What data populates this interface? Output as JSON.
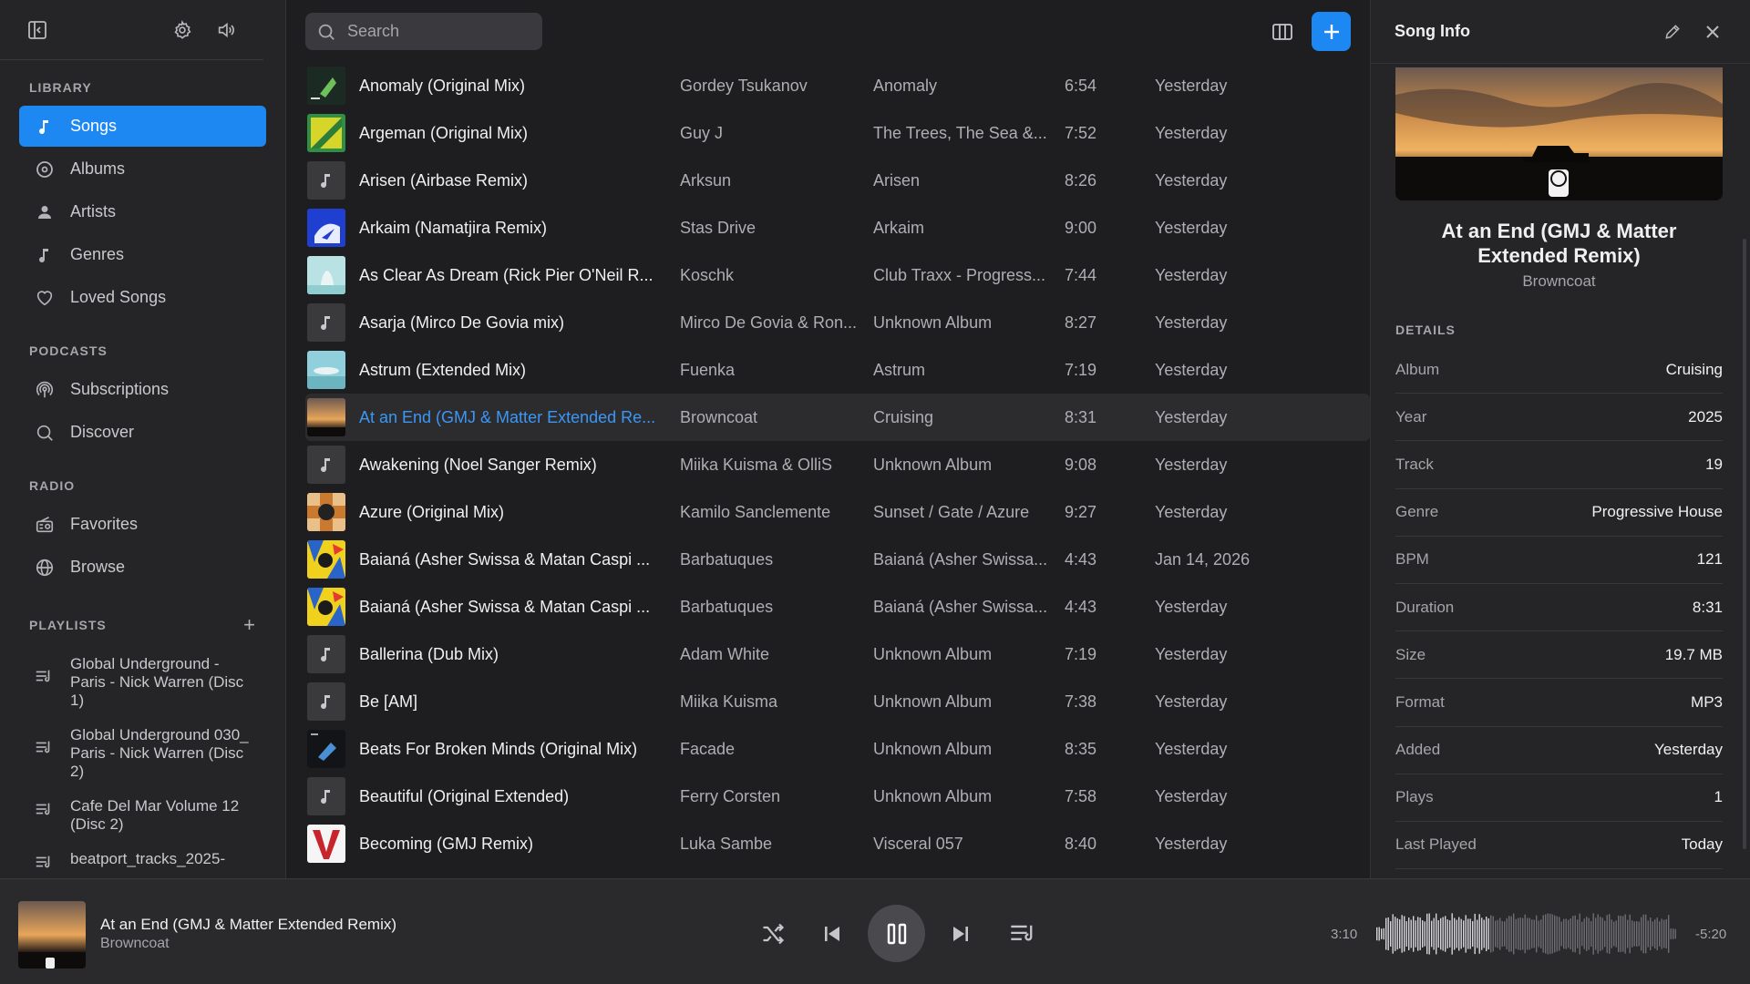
{
  "sidebar": {
    "sections": {
      "library": "LIBRARY",
      "podcasts": "PODCASTS",
      "radio": "RADIO",
      "playlists": "PLAYLISTS"
    },
    "library_items": [
      {
        "label": "Songs",
        "icon": "music-note-icon"
      },
      {
        "label": "Albums",
        "icon": "disc-icon"
      },
      {
        "label": "Artists",
        "icon": "person-icon"
      },
      {
        "label": "Genres",
        "icon": "music-note-icon"
      },
      {
        "label": "Loved Songs",
        "icon": "heart-icon"
      }
    ],
    "podcast_items": [
      {
        "label": "Subscriptions",
        "icon": "podcast-icon"
      },
      {
        "label": "Discover",
        "icon": "search-icon"
      }
    ],
    "radio_items": [
      {
        "label": "Favorites",
        "icon": "radio-icon"
      },
      {
        "label": "Browse",
        "icon": "globe-icon"
      }
    ],
    "playlists": [
      {
        "label": "Global Underground - Paris - Nick Warren (Disc 1)"
      },
      {
        "label": "Global Underground 030_ Paris - Nick Warren (Disc 2)"
      },
      {
        "label": "Cafe Del Mar Volume 12 (Disc 2)"
      },
      {
        "label": "beatport_tracks_2025-"
      }
    ]
  },
  "search": {
    "placeholder": "Search"
  },
  "songs": [
    {
      "title": "Anomaly (Original Mix)",
      "artist": "Gordey Tsukanov",
      "album": "Anomaly",
      "duration": "6:54",
      "added": "Yesterday",
      "art": "dark-green"
    },
    {
      "title": "Argeman (Original Mix)",
      "artist": "Guy J",
      "album": "The Trees, The Sea &...",
      "duration": "7:52",
      "added": "Yesterday",
      "art": "yellow-green"
    },
    {
      "title": "Arisen (Airbase Remix)",
      "artist": "Arksun",
      "album": "Arisen",
      "duration": "8:26",
      "added": "Yesterday",
      "art": "placeholder"
    },
    {
      "title": "Arkaim (Namatjira Remix)",
      "artist": "Stas Drive",
      "album": "Arkaim",
      "duration": "9:00",
      "added": "Yesterday",
      "art": "blue"
    },
    {
      "title": "As Clear As Dream (Rick Pier O'Neil R...",
      "artist": "Koschk",
      "album": "Club Traxx - Progress...",
      "duration": "7:44",
      "added": "Yesterday",
      "art": "teal"
    },
    {
      "title": "Asarja (Mirco De Govia mix)",
      "artist": "Mirco De Govia & Ron...",
      "album": "Unknown Album",
      "duration": "8:27",
      "added": "Yesterday",
      "art": "placeholder"
    },
    {
      "title": "Astrum (Extended Mix)",
      "artist": "Fuenka",
      "album": "Astrum",
      "duration": "7:19",
      "added": "Yesterday",
      "art": "sky"
    },
    {
      "title": "At an End (GMJ & Matter Extended Re...",
      "artist": "Browncoat",
      "album": "Cruising",
      "duration": "8:31",
      "added": "Yesterday",
      "art": "sunset",
      "current": true
    },
    {
      "title": "Awakening (Noel Sanger Remix)",
      "artist": "Miika Kuisma & OlliS",
      "album": "Unknown Album",
      "duration": "9:08",
      "added": "Yesterday",
      "art": "placeholder"
    },
    {
      "title": "Azure (Original Mix)",
      "artist": "Kamilo Sanclemente",
      "album": "Sunset / Gate / Azure",
      "duration": "9:27",
      "added": "Yesterday",
      "art": "checker"
    },
    {
      "title": "Baianá (Asher Swissa & Matan Caspi ...",
      "artist": "Barbatuques",
      "album": "Baianá (Asher Swissa...",
      "duration": "4:43",
      "added": "Jan 14, 2026",
      "art": "colorful"
    },
    {
      "title": "Baianá (Asher Swissa & Matan Caspi ...",
      "artist": "Barbatuques",
      "album": "Baianá (Asher Swissa...",
      "duration": "4:43",
      "added": "Yesterday",
      "art": "colorful"
    },
    {
      "title": "Ballerina (Dub Mix)",
      "artist": "Adam White",
      "album": "Unknown Album",
      "duration": "7:19",
      "added": "Yesterday",
      "art": "placeholder"
    },
    {
      "title": "Be [AM]",
      "artist": "Miika Kuisma",
      "album": "Unknown Album",
      "duration": "7:38",
      "added": "Yesterday",
      "art": "placeholder"
    },
    {
      "title": "Beats For Broken Minds (Original Mix)",
      "artist": "Facade",
      "album": "Unknown Album",
      "duration": "8:35",
      "added": "Yesterday",
      "art": "dark-blue"
    },
    {
      "title": "Beautiful (Original Extended)",
      "artist": "Ferry Corsten",
      "album": "Unknown Album",
      "duration": "7:58",
      "added": "Yesterday",
      "art": "placeholder"
    },
    {
      "title": "Becoming (GMJ Remix)",
      "artist": "Luka Sambe",
      "album": "Visceral 057",
      "duration": "8:40",
      "added": "Yesterday",
      "art": "v-logo"
    }
  ],
  "info": {
    "header": "Song Info",
    "title": "At an End (GMJ & Matter Extended Remix)",
    "artist": "Browncoat",
    "details_label": "DETAILS",
    "details": [
      {
        "key": "Album",
        "value": "Cruising"
      },
      {
        "key": "Year",
        "value": "2025"
      },
      {
        "key": "Track",
        "value": "19"
      },
      {
        "key": "Genre",
        "value": "Progressive House"
      },
      {
        "key": "BPM",
        "value": "121"
      },
      {
        "key": "Duration",
        "value": "8:31"
      },
      {
        "key": "Size",
        "value": "19.7 MB"
      },
      {
        "key": "Format",
        "value": "MP3"
      },
      {
        "key": "Added",
        "value": "Yesterday"
      },
      {
        "key": "Plays",
        "value": "1"
      },
      {
        "key": "Last Played",
        "value": "Today"
      }
    ]
  },
  "player": {
    "title": "At an End (GMJ & Matter Extended Remix)",
    "artist": "Browncoat",
    "elapsed": "3:10",
    "remaining": "-5:20",
    "progress": 0.373
  },
  "colors": {
    "accent": "#1e88f2",
    "current_title": "#3b97f5"
  }
}
